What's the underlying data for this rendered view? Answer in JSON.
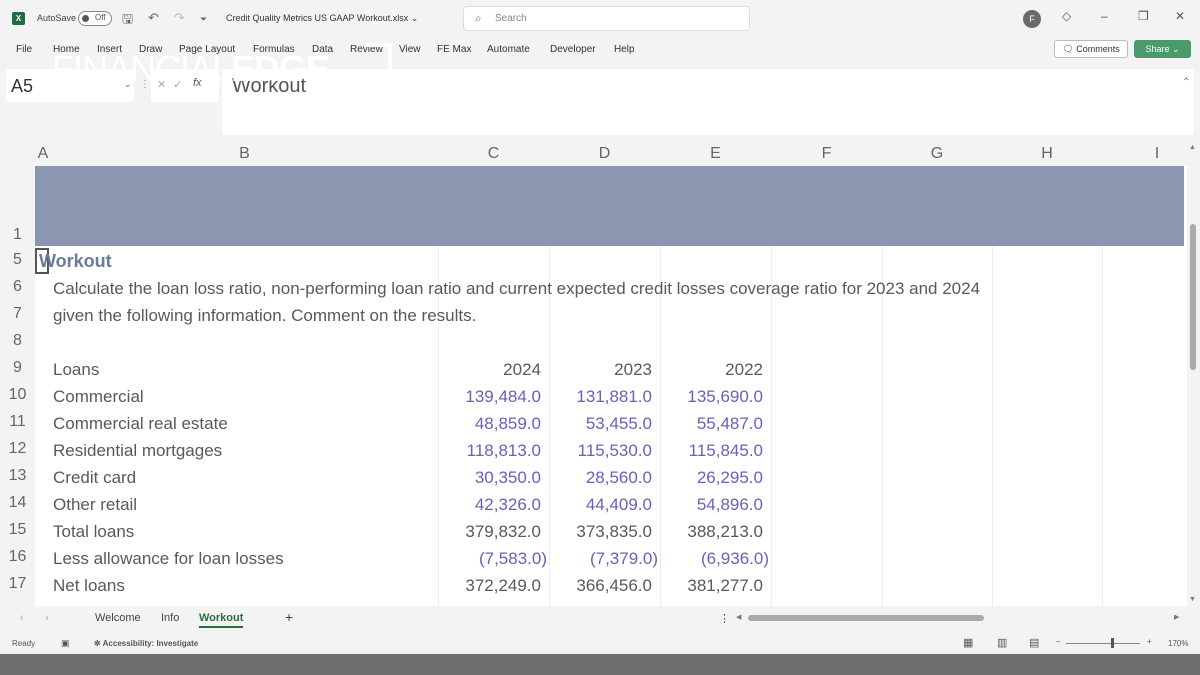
{
  "titlebar": {
    "app_icon": "excel-icon",
    "autosave_label": "AutoSave",
    "autosave_state": "Off",
    "doc_title": "Credit Quality Metrics US GAAP Workout.xlsx",
    "search_placeholder": "Search",
    "avatar_initial": "F"
  },
  "ribbon": {
    "tabs": [
      "File",
      "Home",
      "Insert",
      "Draw",
      "Page Layout",
      "Formulas",
      "Data",
      "Review",
      "View",
      "FE Max",
      "Automate",
      "Developer",
      "Help"
    ],
    "comments_label": "Comments",
    "share_label": "Share"
  },
  "formula_bar": {
    "name_box": "A5",
    "fx": "fx",
    "content": "Workout"
  },
  "columns": [
    "A",
    "B",
    "C",
    "D",
    "E",
    "F",
    "G",
    "H",
    "I"
  ],
  "rows": [
    "1",
    "5",
    "6",
    "7",
    "8",
    "9",
    "10",
    "11",
    "12",
    "13",
    "14",
    "15",
    "16",
    "17"
  ],
  "banner": {
    "logo_light": "FINANCIAL",
    "logo_bold": "EDGE"
  },
  "sheet": {
    "title": "Workout",
    "instruction_line1": "Calculate the loan loss ratio, non-performing loan ratio and current expected credit losses coverage ratio for 2023 and 2024",
    "instruction_line2": "given the following information. Comment on the results.",
    "header_label": "Loans",
    "years": [
      "2024",
      "2023",
      "2022"
    ],
    "table": [
      {
        "label": "Commercial",
        "values": [
          "139,484.0",
          "131,881.0",
          "135,690.0"
        ],
        "input": true
      },
      {
        "label": "Commercial real estate",
        "values": [
          "48,859.0",
          "53,455.0",
          "55,487.0"
        ],
        "input": true
      },
      {
        "label": "Residential mortgages",
        "values": [
          "118,813.0",
          "115,530.0",
          "115,845.0"
        ],
        "input": true
      },
      {
        "label": "Credit card",
        "values": [
          "30,350.0",
          "28,560.0",
          "26,295.0"
        ],
        "input": true
      },
      {
        "label": "Other retail",
        "values": [
          "42,326.0",
          "44,409.0",
          "54,896.0"
        ],
        "input": true
      },
      {
        "label": "Total loans",
        "values": [
          "379,832.0",
          "373,835.0",
          "388,213.0"
        ],
        "input": false
      },
      {
        "label": "Less allowance for loan losses",
        "values": [
          "(7,583.0)",
          "(7,379.0)",
          "(6,936.0)"
        ],
        "input": true
      },
      {
        "label": "Net loans",
        "values": [
          "372,249.0",
          "366,456.0",
          "381,277.0"
        ],
        "input": false
      }
    ]
  },
  "sheet_tabs": [
    "Welcome",
    "Info",
    "Workout"
  ],
  "active_sheet": "Workout",
  "statusbar": {
    "ready": "Ready",
    "accessibility": "Accessibility: Investigate",
    "zoom": "170%"
  },
  "colors": {
    "banner": "#8b97b0",
    "input_blue": "#6a5fbf",
    "share_green": "#4a9a6b"
  }
}
